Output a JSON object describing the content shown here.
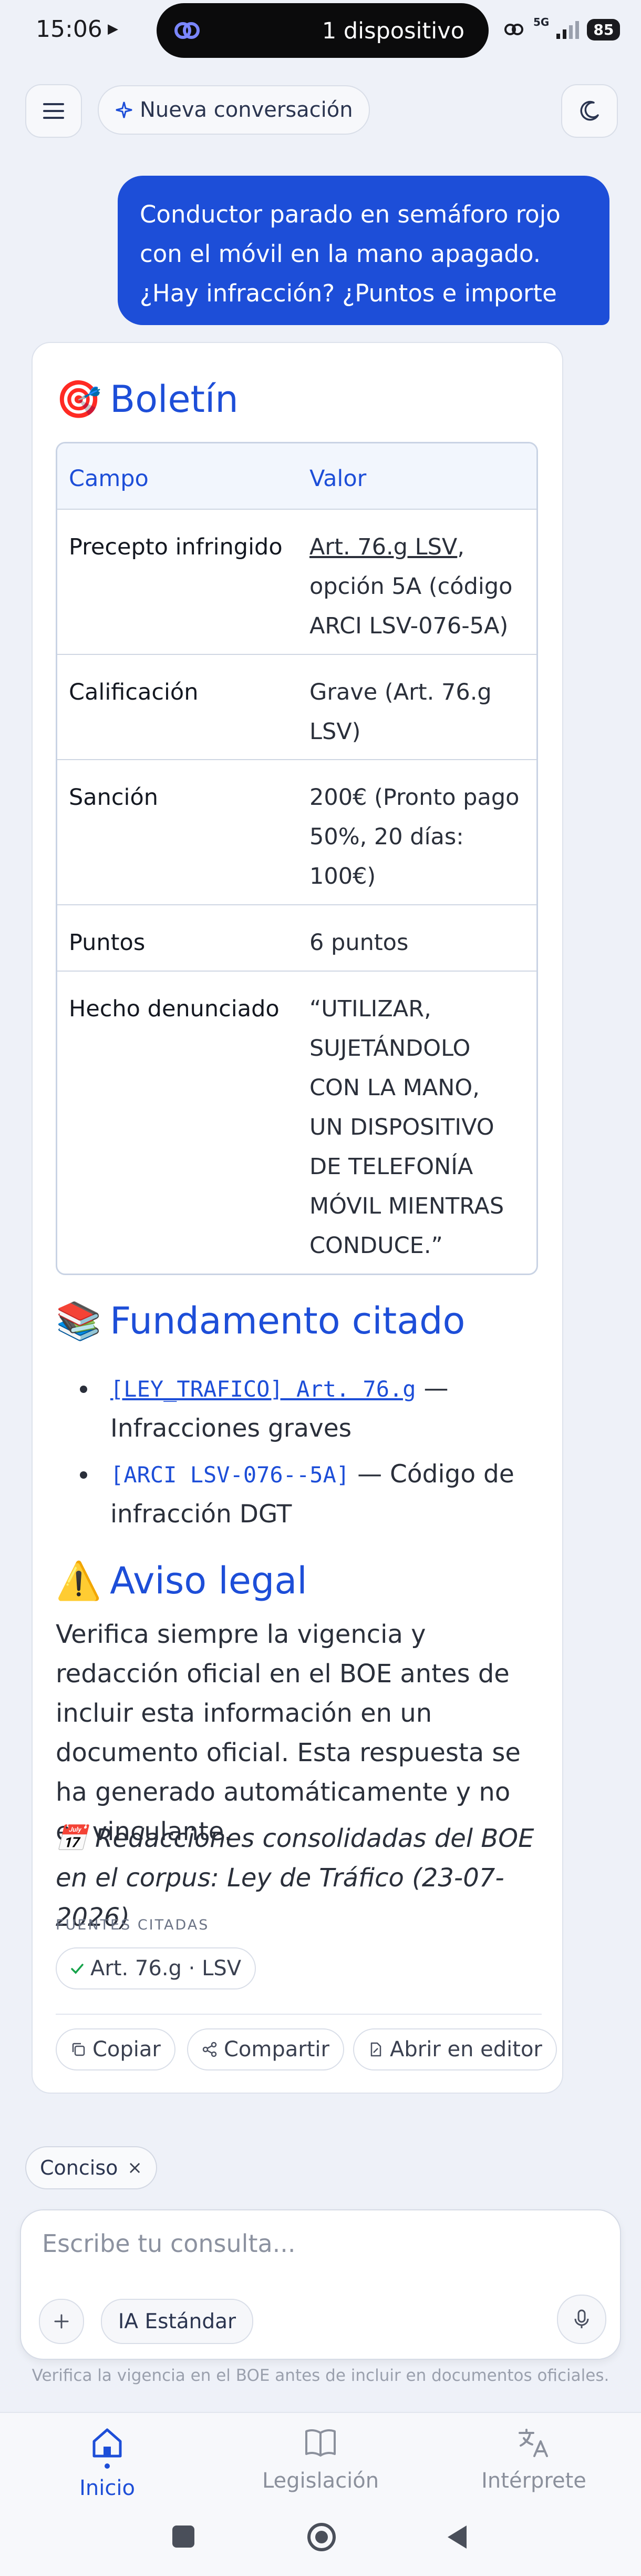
{
  "status_bar": {
    "time": "15:06",
    "island_text": "1 dispositivo",
    "network": "5G",
    "battery": "85"
  },
  "header": {
    "menu_icon": "hamburger-icon",
    "new_chat_label": "Nueva conversación",
    "theme_icon": "moon-icon"
  },
  "user_message": "Conductor parado en semáforo rojo con el móvil en la mano apagado. ¿Hay infracción? ¿Puntos e importe",
  "answer": {
    "bulletin": {
      "emoji": "🎯",
      "title": "Boletín",
      "columns": [
        "Campo",
        "Valor"
      ],
      "rows": [
        {
          "field": "Precepto infringido",
          "value_link": "Art. 76.g LSV",
          "value": ", opción 5A (código ARCI LSV-076-5A)"
        },
        {
          "field": "Calificación",
          "value": "Grave (Art. 76.g LSV)"
        },
        {
          "field": "Sanción",
          "value": "200€ (Pronto pago 50%, 20 días: 100€)"
        },
        {
          "field": "Puntos",
          "value": "6 puntos"
        },
        {
          "field": "Hecho denunciado",
          "value": "“UTILIZAR, SUJETÁNDOLO CON LA MANO, UN DISPOSITIVO DE TELEFONÍA MÓVIL MIENTRAS CONDUCE.”"
        }
      ]
    },
    "fundamento": {
      "emoji": "📚",
      "title": "Fundamento citado",
      "items": [
        {
          "code": "[LEY_TRAFICO] Art. 76.g",
          "text": " — Infracciones graves"
        },
        {
          "code": "[ARCI LSV-076--5A]",
          "text": " — Código de infracción DGT"
        }
      ]
    },
    "aviso": {
      "emoji": "⚠️",
      "title": "Aviso legal",
      "text": "Verifica siempre la vigencia y redacción oficial en el BOE antes de incluir esta información en un documento oficial. Esta respuesta se ha generado automáticamente y no es vinculante.",
      "note_emoji": "📅",
      "note": "Redacciones consolidadas del BOE en el corpus: Ley de Tráfico (23-07-2026)"
    },
    "sources_label": "FUENTES CITADAS",
    "source_chip": "Art. 76.g · LSV",
    "actions": {
      "copy": "Copiar",
      "share": "Compartir",
      "open_editor": "Abrir en editor"
    }
  },
  "mode_chip": "Conciso",
  "composer": {
    "placeholder": "Escribe tu consulta...",
    "model_label": "IA Estándar"
  },
  "footer_note": "Verifica la vigencia en el BOE antes de incluir en documentos oficiales.",
  "bottom_nav": {
    "items": [
      {
        "label": "Inicio",
        "icon": "home-icon",
        "active": true
      },
      {
        "label": "Legislación",
        "icon": "book-icon",
        "active": false
      },
      {
        "label": "Intérprete",
        "icon": "translate-icon",
        "active": false
      }
    ]
  },
  "colors": {
    "accent": "#1d4ed8",
    "background": "#eef1f8",
    "success": "#16a34a"
  }
}
